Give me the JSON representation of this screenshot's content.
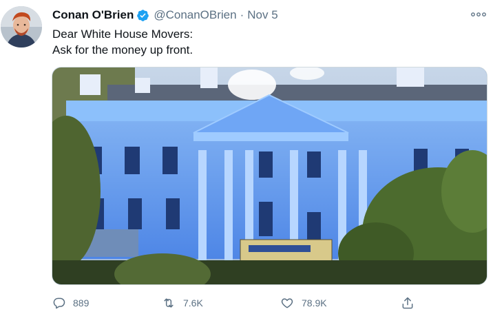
{
  "tweet": {
    "display_name": "Conan O'Brien",
    "handle": "@ConanOBrien",
    "separator": "·",
    "date": "Nov 5",
    "text_line_1": "Dear White House Movers:",
    "text_line_2": "Ask for the money up front.",
    "media_subject": "White House with moving truck",
    "verified": true
  },
  "actions": {
    "replies": "889",
    "retweets": "7.6K",
    "likes": "78.9K"
  },
  "icons": {
    "verified": "verified-badge-icon",
    "more": "more-options-icon",
    "reply": "reply-icon",
    "retweet": "retweet-icon",
    "like": "like-icon",
    "share": "share-icon"
  },
  "colors": {
    "verified": "#1da1f2",
    "secondary_text": "#5b7083",
    "primary_text": "#0f1419"
  }
}
